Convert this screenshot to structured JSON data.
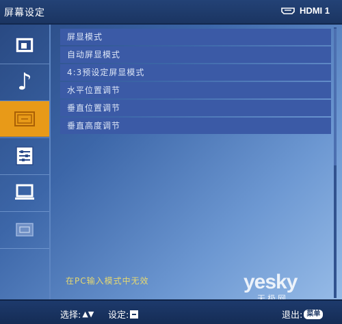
{
  "header": {
    "title": "屏幕设定",
    "input_source": "HDMI 1"
  },
  "sidebar": {
    "items": [
      {
        "name": "picture-icon",
        "selected": false
      },
      {
        "name": "music-note-icon",
        "selected": false
      },
      {
        "name": "screen-icon",
        "selected": true
      },
      {
        "name": "settings-list-icon",
        "selected": false
      },
      {
        "name": "monitor-icon",
        "selected": false
      },
      {
        "name": "pc-input-icon",
        "selected": false
      }
    ],
    "accent_color": "#e89a18"
  },
  "menu": {
    "items": [
      {
        "label": "屏显模式"
      },
      {
        "label": "自动屏显模式"
      },
      {
        "label": "4:3预设定屏显模式"
      },
      {
        "label": "水平位置调节"
      },
      {
        "label": "垂直位置调节"
      },
      {
        "label": "垂直高度调节"
      }
    ]
  },
  "notice": "在PC输入模式中无效",
  "footer": {
    "select_label": "选择:",
    "set_label": "设定:",
    "exit_label": "退出:",
    "menu_key": "菜单"
  },
  "watermark": {
    "brand": "yesky",
    "sub": "天极网"
  }
}
